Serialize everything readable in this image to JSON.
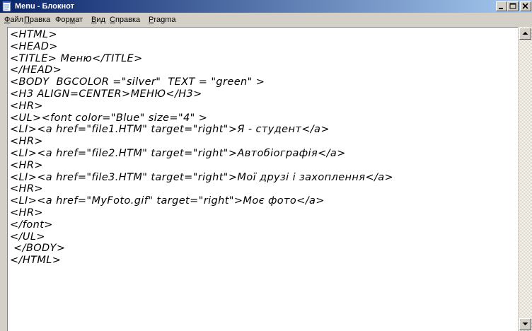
{
  "window": {
    "title": "Menu - Блокнот",
    "app_icon": "notepad-icon",
    "controls": {
      "minimize": "minimize-icon",
      "maximize": "maximize-icon",
      "close": "close-icon"
    }
  },
  "menu": [
    {
      "underline": "Ф",
      "rest": "айл"
    },
    {
      "underline": "П",
      "rest": "равка"
    },
    {
      "pre": "Фор",
      "underline": "м",
      "rest": "ат"
    },
    {
      "underline": "В",
      "rest": "ид"
    },
    {
      "underline": "С",
      "rest": "правка"
    },
    {
      "underline": "P",
      "rest": "ragma"
    }
  ],
  "editor": {
    "text": "<HTML>\n<HEAD>\n<TITLE> Меню</TITLE>\n</HEAD>\n<BODY  BGCOLOR =\"silver\"  TEXT = \"green\" >\n<H3 ALIGN=CENTER>МЕНЮ</H3>\n<HR>\n<UL><font color=\"Blue\" size=\"4\" >\n<LI><a href=\"file1.HTM\" target=\"right\">Я - студент</a>\n<HR>\n<LI><a href=\"file2.HTM\" target=\"right\">Автобіографія</a>\n<HR>\n<LI><a href=\"file3.HTM\" target=\"right\">Мої друзі і захоплення</a>\n<HR>\n<LI><a href=\"MyFoto.gif\" target=\"right\">Моє фото</a>\n<HR>\n</font>\n</UL>\n </BODY>\n</HTML>"
  },
  "scrollbar": {
    "up": "scroll-up-arrow-icon",
    "down": "scroll-down-arrow-icon"
  },
  "colors": {
    "title_start": "#0a246a",
    "title_end": "#a6caf0",
    "chrome": "#d4d0c8"
  }
}
